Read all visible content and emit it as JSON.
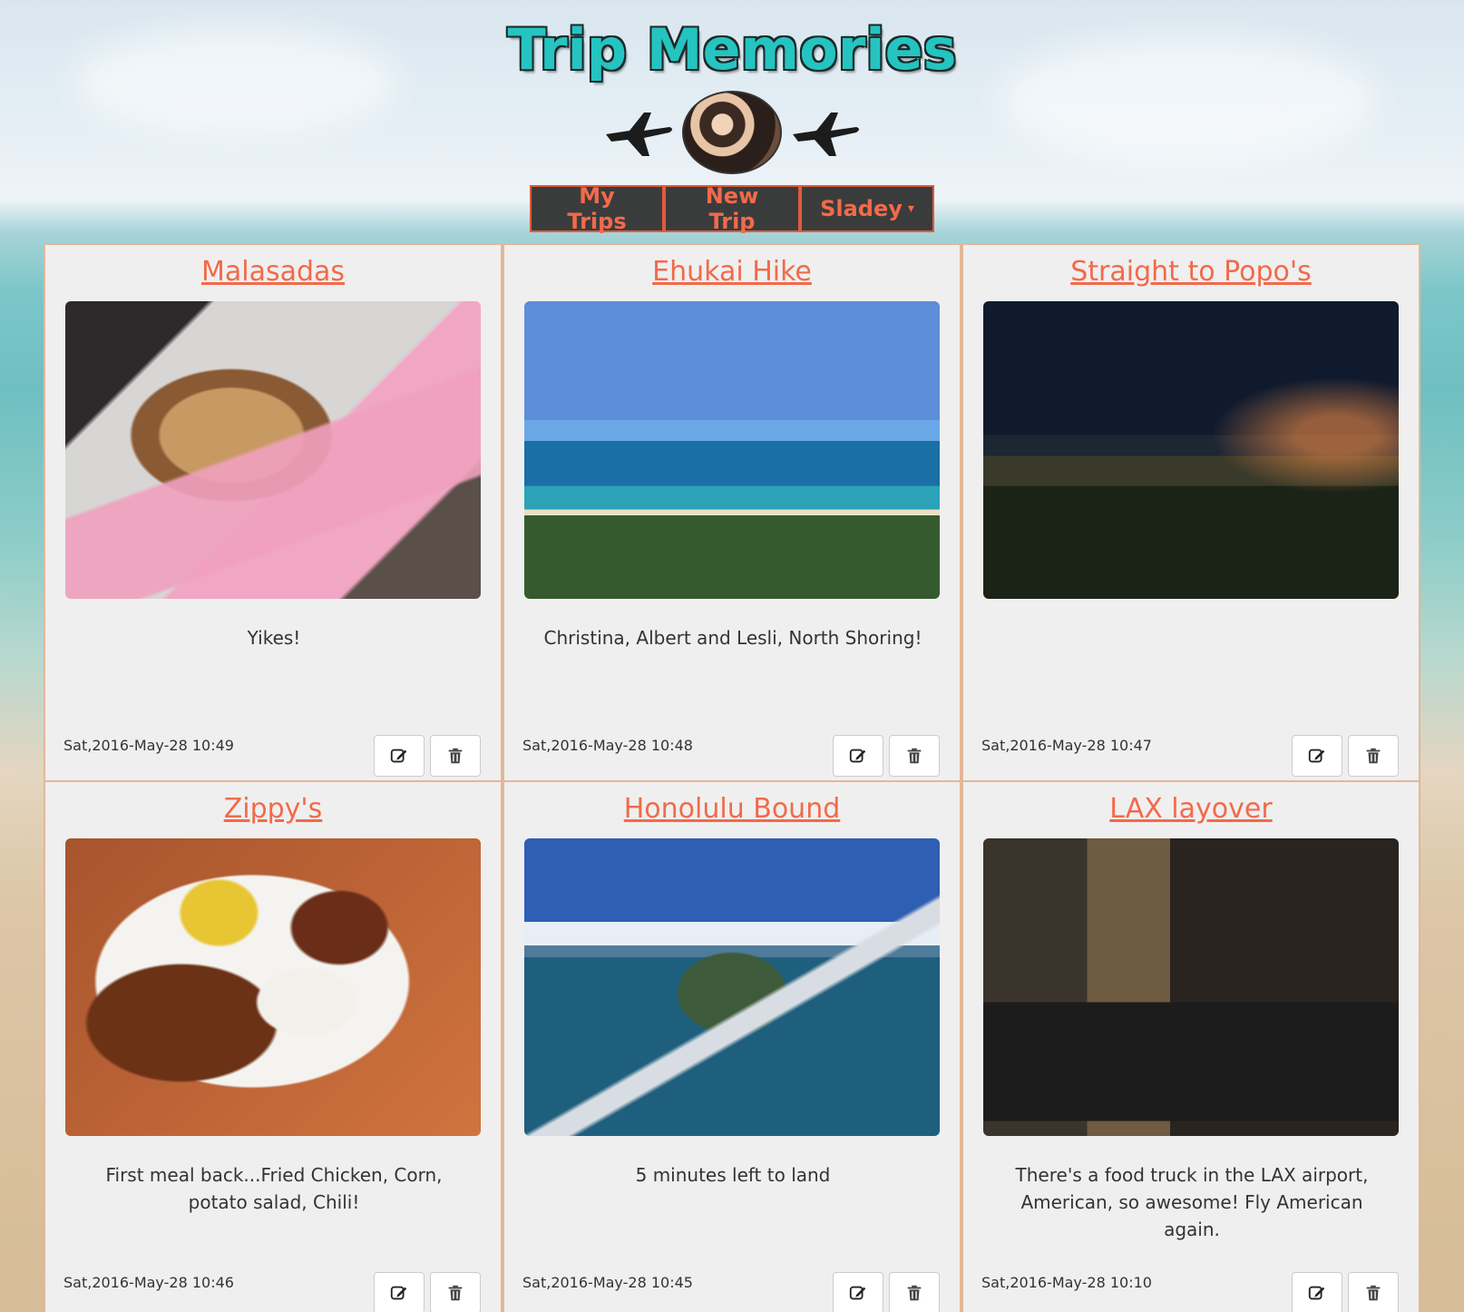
{
  "header": {
    "title": "Trip Memories",
    "icons": [
      "airplane-icon",
      "avatar",
      "airplane-icon"
    ]
  },
  "nav": {
    "my_trips": "My Trips",
    "new_trip": "New Trip",
    "user": "Sladey",
    "user_caret": "▾"
  },
  "colors": {
    "title": "#25c4c0",
    "accent": "#f26a4b",
    "nav_bg": "#3a3c3c",
    "card_bg": "#efefef",
    "card_border": "#e2b79a"
  },
  "trips": [
    {
      "title": "Malasadas",
      "description": "Yikes!",
      "date": "Sat,2016-May-28 10:49"
    },
    {
      "title": "Ehukai Hike",
      "description": "Christina, Albert and Lesli, North Shoring!",
      "date": "Sat,2016-May-28 10:48"
    },
    {
      "title": "Straight to Popo's",
      "description": "",
      "date": "Sat,2016-May-28 10:47"
    },
    {
      "title": "Zippy's",
      "description": "First meal back...Fried Chicken, Corn, potato salad, Chili!",
      "date": "Sat,2016-May-28 10:46"
    },
    {
      "title": "Honolulu Bound",
      "description": "5 minutes left to land",
      "date": "Sat,2016-May-28 10:45"
    },
    {
      "title": "LAX layover",
      "description": "There's a food truck in the LAX airport, American, so awesome! Fly American again.",
      "date": "Sat,2016-May-28 10:10"
    }
  ]
}
